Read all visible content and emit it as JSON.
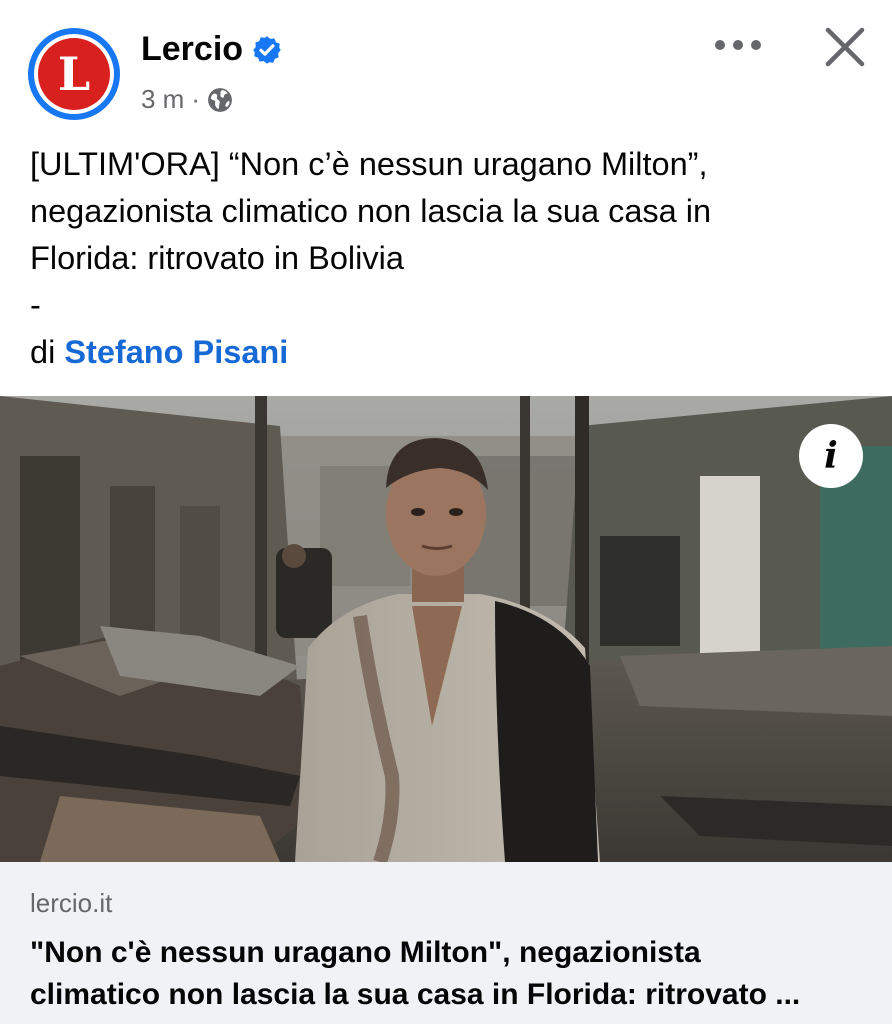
{
  "post": {
    "author": "Lercio",
    "avatar_letter": "L",
    "time": "3 m",
    "separator": "·",
    "text_line1": "[ULTIM'ORA] “Non c’è nessun uragano Milton”,",
    "text_line2": "negazionista climatico non lascia la sua casa in",
    "text_line3": "Florida: ritrovato in Bolivia",
    "text_dash": "-",
    "byline_prefix": "di ",
    "byline_author": "Stefano Pisani",
    "info_label": "i"
  },
  "link": {
    "domain": "lercio.it",
    "title_line1": "\"Non c'è nessun uragano Milton\", negazionista",
    "title_line2": "climatico non lascia la sua casa in Florida: ritrovato ..."
  },
  "icons": {
    "verified": "verified-badge-icon",
    "audience": "globe-icon",
    "more": "more-options-icon",
    "close": "close-icon",
    "info": "info-icon"
  },
  "colors": {
    "brand_blue": "#1877f2",
    "link_blue": "#1769d6",
    "lercio_red": "#d8201f",
    "secondary_text": "#65676b",
    "card_background": "#f0f2f5"
  }
}
